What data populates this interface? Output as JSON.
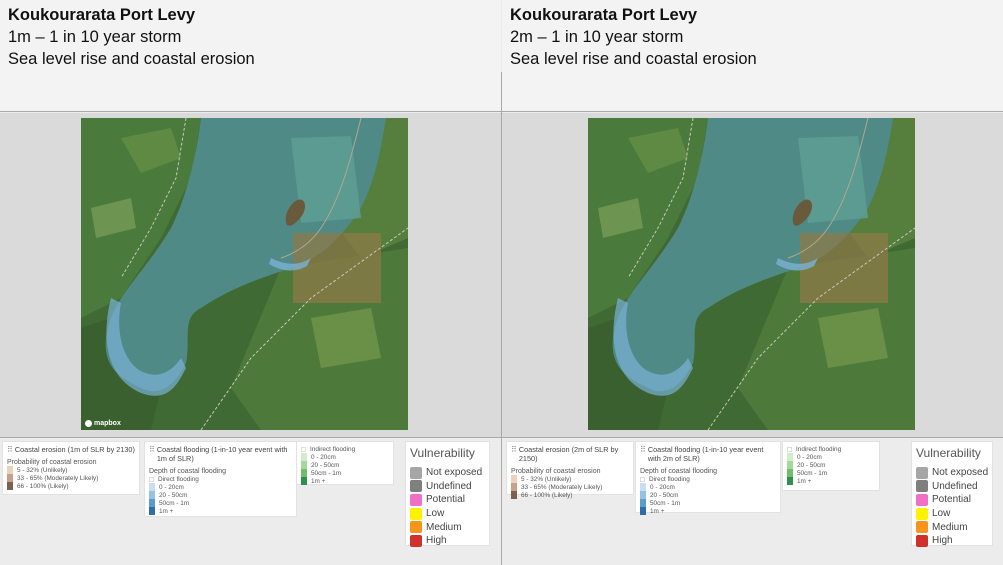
{
  "panels": [
    {
      "title": "Koukourarata Port Levy",
      "line1": "1m – 1 in 10 year storm",
      "line2": "Sea level rise and coastal erosion",
      "attribution": "mapbox",
      "erosion": {
        "title": "Coastal erosion (1m of SLR by 2130)",
        "subtitle": "Probability of coastal erosion",
        "items": [
          {
            "label": "5 - 32% (Unlikely)",
            "color": "#ecd2bd"
          },
          {
            "label": "33 - 65% (Moderately Likely)",
            "color": "#c7a18a"
          },
          {
            "label": "66 - 100% (Likely)",
            "color": "#7d6150"
          }
        ]
      },
      "flooding": {
        "title": "Coastal flooding (1-in-10 year event with 1m of SLR)",
        "subtitle": "Depth of coastal flooding",
        "group": "Direct flooding",
        "items": [
          {
            "label": "0 - 20cm",
            "color": "#c7dff0"
          },
          {
            "label": "20 - 50cm",
            "color": "#93c2e2"
          },
          {
            "label": "50cm - 1m",
            "color": "#5b9ccc"
          },
          {
            "label": "1m +",
            "color": "#2f6ea8"
          }
        ]
      },
      "indirect": {
        "title": "Indirect flooding",
        "items": [
          {
            "label": "0 - 20cm",
            "color": "#d2ecc9"
          },
          {
            "label": "20 - 50cm",
            "color": "#a7d89b"
          },
          {
            "label": "50cm - 1m",
            "color": "#6dbf6b"
          },
          {
            "label": "1m +",
            "color": "#2f8f4e"
          }
        ]
      }
    },
    {
      "title": "Koukourarata Port Levy",
      "line1": "2m – 1 in 10 year storm",
      "line2": "Sea level rise and coastal erosion",
      "erosion": {
        "title": "Coastal erosion (2m of SLR by 2150)",
        "subtitle": "Probability of coastal erosion",
        "items": [
          {
            "label": "5 - 32% (Unlikely)",
            "color": "#ecd2bd"
          },
          {
            "label": "33 - 65% (Moderately Likely)",
            "color": "#c7a18a"
          },
          {
            "label": "66 - 100% (Likely)",
            "color": "#7d6150"
          }
        ]
      },
      "flooding": {
        "title": "Coastal flooding (1-in-10 year event with 2m of SLR)",
        "subtitle": "Depth of coastal flooding",
        "group": "Direct flooding",
        "items": [
          {
            "label": "0 - 20cm",
            "color": "#c7dff0"
          },
          {
            "label": "20 - 50cm",
            "color": "#93c2e2"
          },
          {
            "label": "50cm - 1m",
            "color": "#5b9ccc"
          },
          {
            "label": "1m +",
            "color": "#2f6ea8"
          }
        ]
      },
      "indirect": {
        "title": "Indirect flooding",
        "items": [
          {
            "label": "0 - 20cm",
            "color": "#d2ecc9"
          },
          {
            "label": "20 - 50cm",
            "color": "#a7d89b"
          },
          {
            "label": "50cm - 1m",
            "color": "#6dbf6b"
          },
          {
            "label": "1m +",
            "color": "#2f8f4e"
          }
        ]
      }
    }
  ],
  "vulnerability": {
    "title": "Vulnerability",
    "items": [
      {
        "label": "Not exposed",
        "color": "#a6a6a6"
      },
      {
        "label": "Undefined",
        "color": "#7f7f7f"
      },
      {
        "label": "Potential",
        "color": "#f070c8"
      },
      {
        "label": "Low",
        "color": "#fff200"
      },
      {
        "label": "Medium",
        "color": "#f7941d"
      },
      {
        "label": "High",
        "color": "#d0312d"
      }
    ]
  }
}
